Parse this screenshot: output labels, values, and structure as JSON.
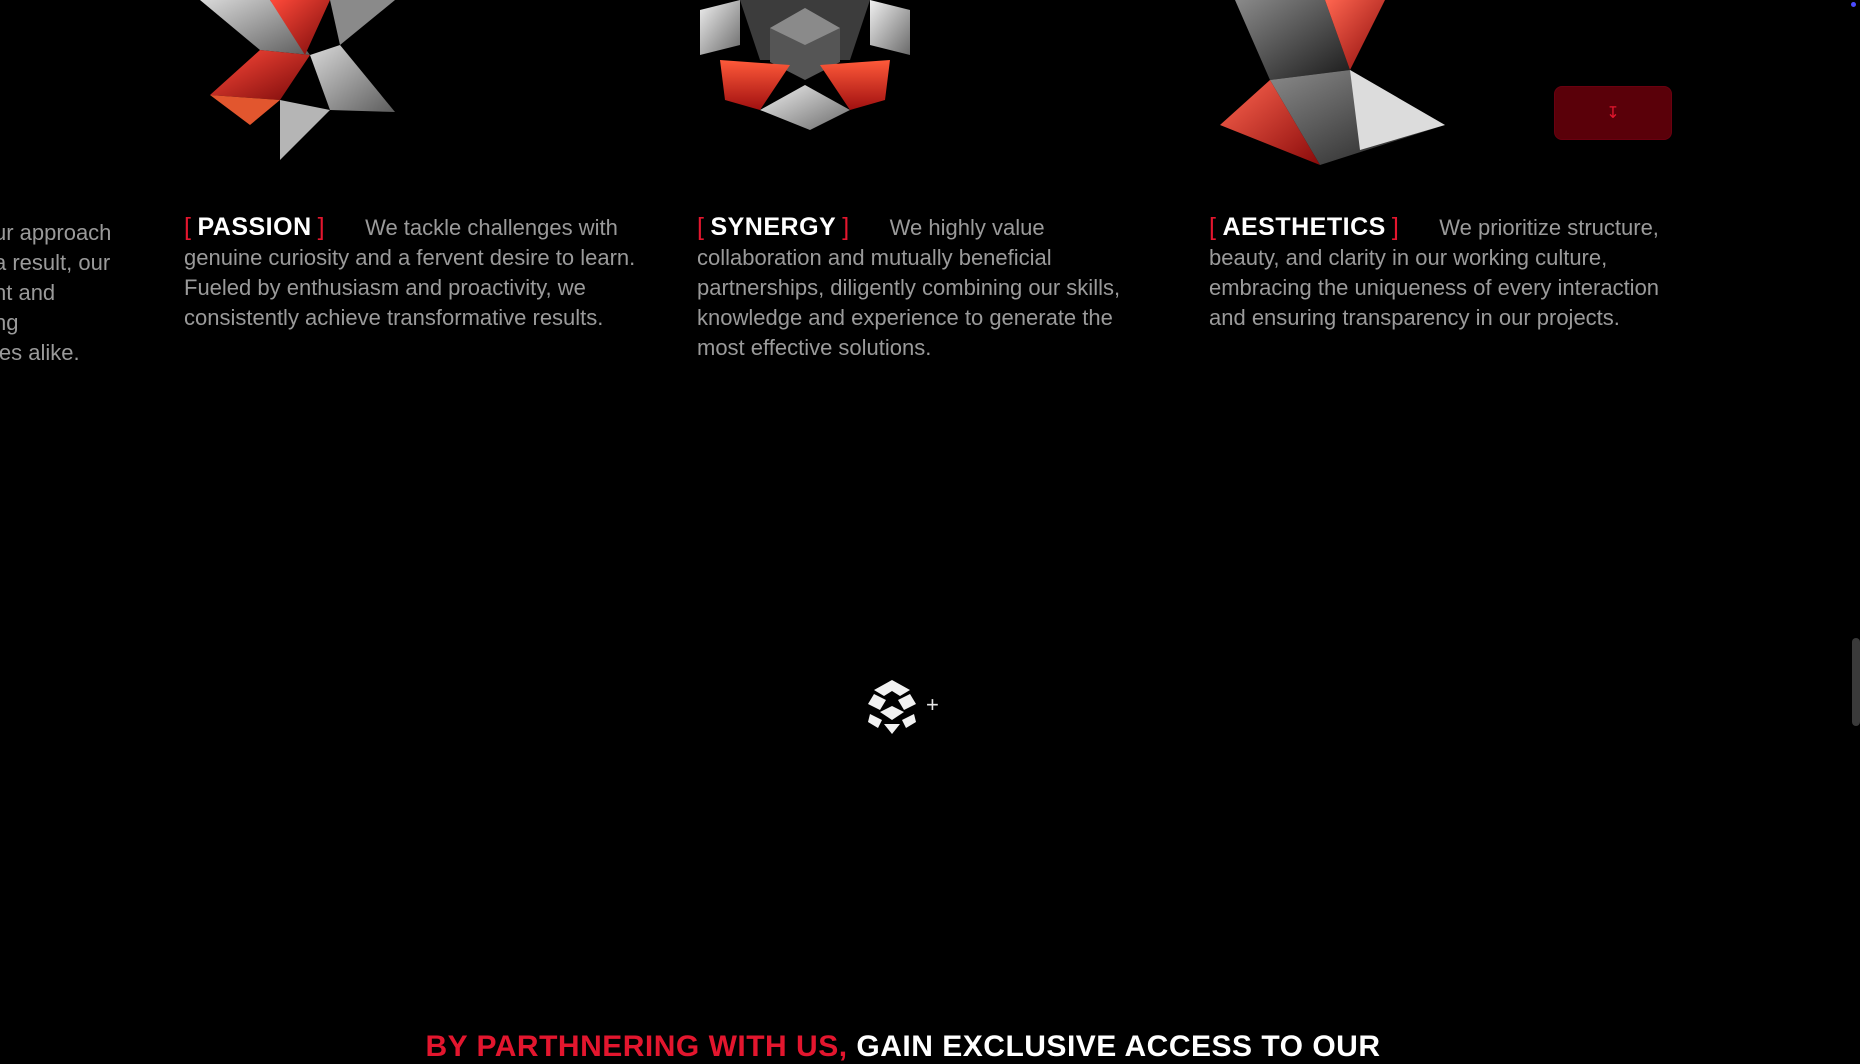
{
  "values": {
    "cut_column_lines": [
      "ur approach",
      "a result, our",
      "ht and",
      "ng",
      "ies alike."
    ],
    "items": [
      {
        "key": "passion",
        "open_bracket": "[",
        "title": "PASSION",
        "close_bracket": "]",
        "description": "We tackle challenges with genuine curiosity and a fervent desire to learn. Fueled by enthusiasm and proactivity, we consistently achieve transformative results."
      },
      {
        "key": "synergy",
        "open_bracket": "[",
        "title": "SYNERGY",
        "close_bracket": "]",
        "description": "We highly value collaboration and mutually beneficial partnerships, diligently combining our skills, knowledge and experience to generate the most effective solutions."
      },
      {
        "key": "aesthetics",
        "open_bracket": "[",
        "title": "AESTHETICS",
        "close_bracket": "]",
        "description": "We prioritize structure, beauty, and clarity in our working culture, embracing the uniqueness of every interaction and ensuring transparency in our projects."
      }
    ]
  },
  "controls": {
    "red_button_icon": "arrow-down-icon",
    "plus_symbol": "+"
  },
  "cta": {
    "red_text": "BY PARTHNERING WITH US,",
    "white_text": "GAIN EXCLUSIVE ACCESS TO OUR"
  },
  "colors": {
    "background": "#000000",
    "accent_red": "#e3162e",
    "body_text": "#9a9a9a",
    "heading_text": "#ffffff"
  }
}
